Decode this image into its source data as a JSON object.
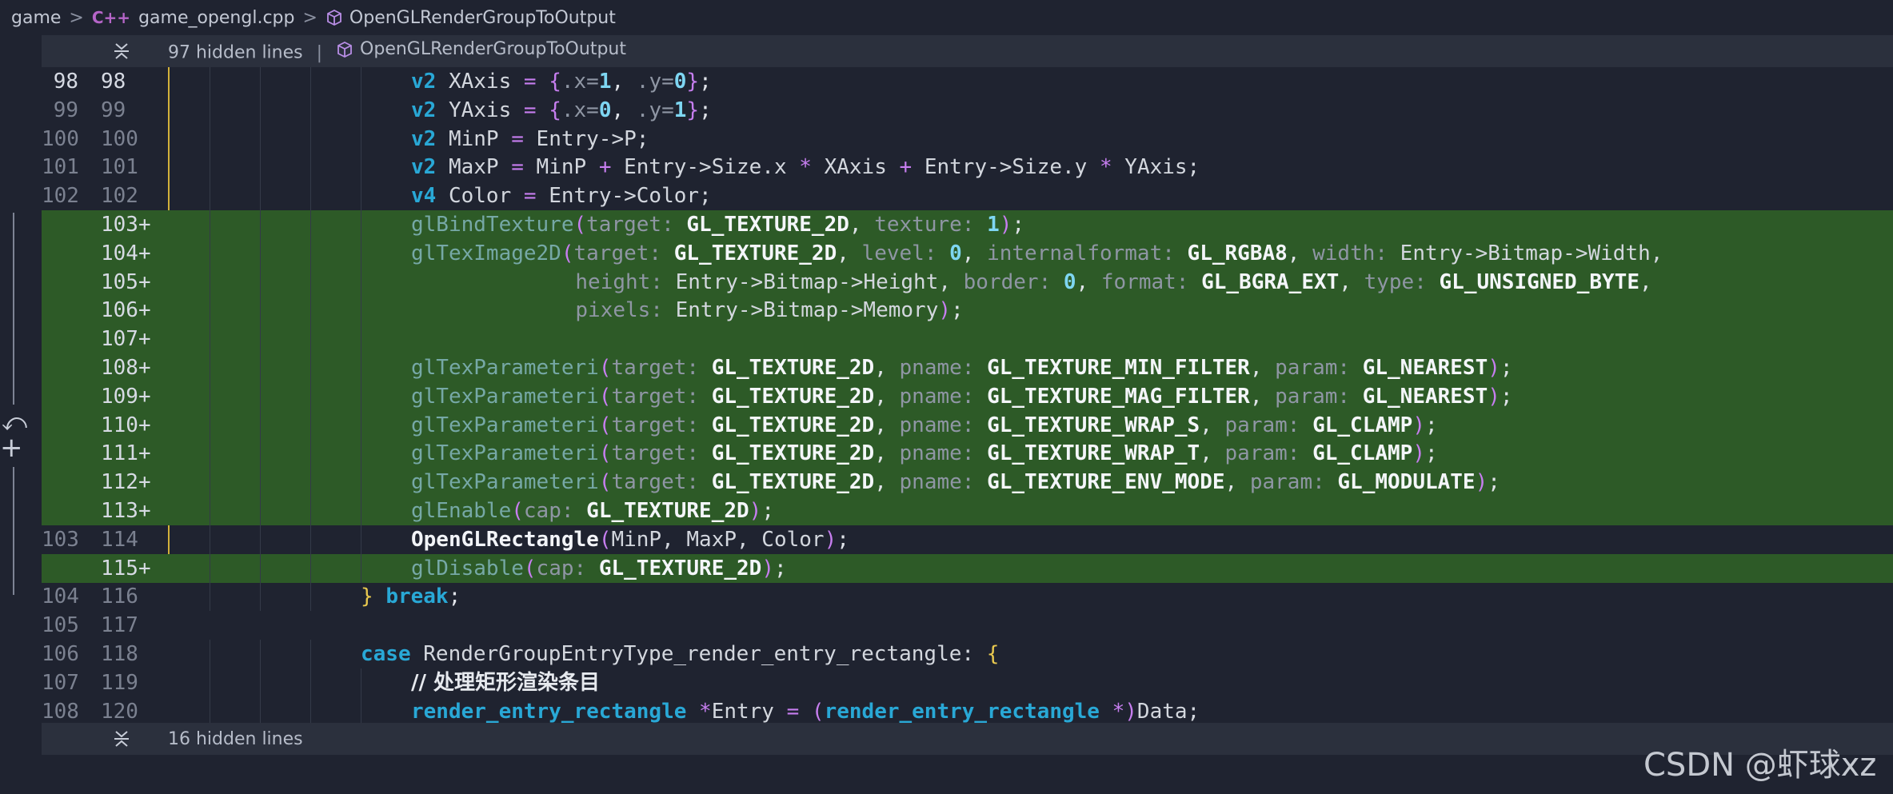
{
  "breadcrumb": {
    "folder": "game",
    "file": "game_opengl.cpp",
    "file_icon": "C++",
    "symbol": "OpenGLRenderGroupToOutput"
  },
  "fold_top": {
    "label": "97 hidden lines",
    "separator": "|",
    "function": "OpenGLRenderGroupToOutput"
  },
  "fold_bottom": {
    "label": "16 hidden lines"
  },
  "colors": {
    "background": "#1f2330",
    "added_line": "#2d5a27",
    "keyword": "#29a8d6",
    "change_marker": "#d2b13a"
  },
  "lines": [
    {
      "old": "98",
      "new": "98",
      "added": false,
      "current": true,
      "indent": 4,
      "tokens": [
        {
          "t": "v2",
          "c": "kw"
        },
        {
          "t": " XAxis ",
          "c": "plain"
        },
        {
          "t": "=",
          "c": "op"
        },
        {
          "t": " ",
          "c": "plain"
        },
        {
          "t": "{",
          "c": "op"
        },
        {
          "t": ".x=",
          "c": "hint"
        },
        {
          "t": "1",
          "c": "num"
        },
        {
          "t": ", ",
          "c": "pun"
        },
        {
          "t": ".y=",
          "c": "hint"
        },
        {
          "t": "0",
          "c": "num"
        },
        {
          "t": "}",
          "c": "op"
        },
        {
          "t": ";",
          "c": "pun"
        }
      ]
    },
    {
      "old": "99",
      "new": "99",
      "added": false,
      "indent": 4,
      "tokens": [
        {
          "t": "v2",
          "c": "kw"
        },
        {
          "t": " YAxis ",
          "c": "plain"
        },
        {
          "t": "=",
          "c": "op"
        },
        {
          "t": " ",
          "c": "plain"
        },
        {
          "t": "{",
          "c": "op"
        },
        {
          "t": ".x=",
          "c": "hint"
        },
        {
          "t": "0",
          "c": "num"
        },
        {
          "t": ", ",
          "c": "pun"
        },
        {
          "t": ".y=",
          "c": "hint"
        },
        {
          "t": "1",
          "c": "num"
        },
        {
          "t": "}",
          "c": "op"
        },
        {
          "t": ";",
          "c": "pun"
        }
      ]
    },
    {
      "old": "100",
      "new": "100",
      "added": false,
      "indent": 4,
      "tokens": [
        {
          "t": "v2",
          "c": "kw"
        },
        {
          "t": " MinP ",
          "c": "plain"
        },
        {
          "t": "=",
          "c": "op"
        },
        {
          "t": " Entry->P;",
          "c": "plain"
        }
      ]
    },
    {
      "old": "101",
      "new": "101",
      "added": false,
      "indent": 4,
      "tokens": [
        {
          "t": "v2",
          "c": "kw"
        },
        {
          "t": " MaxP ",
          "c": "plain"
        },
        {
          "t": "=",
          "c": "op"
        },
        {
          "t": " MinP ",
          "c": "plain"
        },
        {
          "t": "+",
          "c": "op"
        },
        {
          "t": " Entry->Size.x ",
          "c": "plain"
        },
        {
          "t": "*",
          "c": "op"
        },
        {
          "t": " XAxis ",
          "c": "plain"
        },
        {
          "t": "+",
          "c": "op"
        },
        {
          "t": " Entry->Size.y ",
          "c": "plain"
        },
        {
          "t": "*",
          "c": "op"
        },
        {
          "t": " YAxis;",
          "c": "plain"
        }
      ]
    },
    {
      "old": "102",
      "new": "102",
      "added": false,
      "indent": 4,
      "tokens": [
        {
          "t": "v4",
          "c": "kw"
        },
        {
          "t": " Color ",
          "c": "plain"
        },
        {
          "t": "=",
          "c": "op"
        },
        {
          "t": " Entry->Color;",
          "c": "plain"
        }
      ]
    },
    {
      "old": "",
      "new": "103+",
      "added": true,
      "indent": 4,
      "tokens": [
        {
          "t": "glBindTexture",
          "c": "gfn"
        },
        {
          "t": "(",
          "c": "op"
        },
        {
          "t": "target:",
          "c": "hint"
        },
        {
          "t": " GL_TEXTURE_2D",
          "c": "const"
        },
        {
          "t": ", ",
          "c": "pun"
        },
        {
          "t": "texture:",
          "c": "hint"
        },
        {
          "t": " 1",
          "c": "num"
        },
        {
          "t": ")",
          "c": "op"
        },
        {
          "t": ";",
          "c": "pun"
        }
      ]
    },
    {
      "old": "",
      "new": "104+",
      "added": true,
      "indent": 4,
      "tokens": [
        {
          "t": "glTexImage2D",
          "c": "gfn"
        },
        {
          "t": "(",
          "c": "op"
        },
        {
          "t": "target:",
          "c": "hint"
        },
        {
          "t": " GL_TEXTURE_2D",
          "c": "const"
        },
        {
          "t": ", ",
          "c": "pun"
        },
        {
          "t": "level:",
          "c": "hint"
        },
        {
          "t": " 0",
          "c": "num"
        },
        {
          "t": ", ",
          "c": "pun"
        },
        {
          "t": "internalformat:",
          "c": "hint"
        },
        {
          "t": " GL_RGBA8",
          "c": "const"
        },
        {
          "t": ", ",
          "c": "pun"
        },
        {
          "t": "width:",
          "c": "hint"
        },
        {
          "t": " Entry->Bitmap->Width,",
          "c": "plain"
        }
      ]
    },
    {
      "old": "",
      "new": "105+",
      "added": true,
      "indent": 4,
      "extra_col": 13,
      "tokens": [
        {
          "t": "height:",
          "c": "hint"
        },
        {
          "t": " Entry->Bitmap->Height, ",
          "c": "plain"
        },
        {
          "t": "border:",
          "c": "hint"
        },
        {
          "t": " 0",
          "c": "num"
        },
        {
          "t": ", ",
          "c": "pun"
        },
        {
          "t": "format:",
          "c": "hint"
        },
        {
          "t": " GL_BGRA_EXT",
          "c": "const"
        },
        {
          "t": ", ",
          "c": "pun"
        },
        {
          "t": "type:",
          "c": "hint"
        },
        {
          "t": " GL_UNSIGNED_BYTE",
          "c": "const"
        },
        {
          "t": ",",
          "c": "pun"
        }
      ]
    },
    {
      "old": "",
      "new": "106+",
      "added": true,
      "indent": 4,
      "extra_col": 13,
      "tokens": [
        {
          "t": "pixels:",
          "c": "hint"
        },
        {
          "t": " Entry->Bitmap->Memory",
          "c": "plain"
        },
        {
          "t": ")",
          "c": "op"
        },
        {
          "t": ";",
          "c": "pun"
        }
      ]
    },
    {
      "old": "",
      "new": "107+",
      "added": true,
      "indent": 4,
      "tokens": []
    },
    {
      "old": "",
      "new": "108+",
      "added": true,
      "indent": 4,
      "tokens": [
        {
          "t": "glTexParameteri",
          "c": "gfn"
        },
        {
          "t": "(",
          "c": "op"
        },
        {
          "t": "target:",
          "c": "hint"
        },
        {
          "t": " GL_TEXTURE_2D",
          "c": "const"
        },
        {
          "t": ", ",
          "c": "pun"
        },
        {
          "t": "pname:",
          "c": "hint"
        },
        {
          "t": " GL_TEXTURE_MIN_FILTER",
          "c": "const"
        },
        {
          "t": ", ",
          "c": "pun"
        },
        {
          "t": "param:",
          "c": "hint"
        },
        {
          "t": " GL_NEAREST",
          "c": "const"
        },
        {
          "t": ")",
          "c": "op"
        },
        {
          "t": ";",
          "c": "pun"
        }
      ]
    },
    {
      "old": "",
      "new": "109+",
      "added": true,
      "indent": 4,
      "tokens": [
        {
          "t": "glTexParameteri",
          "c": "gfn"
        },
        {
          "t": "(",
          "c": "op"
        },
        {
          "t": "target:",
          "c": "hint"
        },
        {
          "t": " GL_TEXTURE_2D",
          "c": "const"
        },
        {
          "t": ", ",
          "c": "pun"
        },
        {
          "t": "pname:",
          "c": "hint"
        },
        {
          "t": " GL_TEXTURE_MAG_FILTER",
          "c": "const"
        },
        {
          "t": ", ",
          "c": "pun"
        },
        {
          "t": "param:",
          "c": "hint"
        },
        {
          "t": " GL_NEAREST",
          "c": "const"
        },
        {
          "t": ")",
          "c": "op"
        },
        {
          "t": ";",
          "c": "pun"
        }
      ]
    },
    {
      "old": "",
      "new": "110+",
      "added": true,
      "indent": 4,
      "tokens": [
        {
          "t": "glTexParameteri",
          "c": "gfn"
        },
        {
          "t": "(",
          "c": "op"
        },
        {
          "t": "target:",
          "c": "hint"
        },
        {
          "t": " GL_TEXTURE_2D",
          "c": "const"
        },
        {
          "t": ", ",
          "c": "pun"
        },
        {
          "t": "pname:",
          "c": "hint"
        },
        {
          "t": " GL_TEXTURE_WRAP_S",
          "c": "const"
        },
        {
          "t": ", ",
          "c": "pun"
        },
        {
          "t": "param:",
          "c": "hint"
        },
        {
          "t": " GL_CLAMP",
          "c": "const"
        },
        {
          "t": ")",
          "c": "op"
        },
        {
          "t": ";",
          "c": "pun"
        }
      ]
    },
    {
      "old": "",
      "new": "111+",
      "added": true,
      "indent": 4,
      "tokens": [
        {
          "t": "glTexParameteri",
          "c": "gfn"
        },
        {
          "t": "(",
          "c": "op"
        },
        {
          "t": "target:",
          "c": "hint"
        },
        {
          "t": " GL_TEXTURE_2D",
          "c": "const"
        },
        {
          "t": ", ",
          "c": "pun"
        },
        {
          "t": "pname:",
          "c": "hint"
        },
        {
          "t": " GL_TEXTURE_WRAP_T",
          "c": "const"
        },
        {
          "t": ", ",
          "c": "pun"
        },
        {
          "t": "param:",
          "c": "hint"
        },
        {
          "t": " GL_CLAMP",
          "c": "const"
        },
        {
          "t": ")",
          "c": "op"
        },
        {
          "t": ";",
          "c": "pun"
        }
      ]
    },
    {
      "old": "",
      "new": "112+",
      "added": true,
      "indent": 4,
      "tokens": [
        {
          "t": "glTexParameteri",
          "c": "gfn"
        },
        {
          "t": "(",
          "c": "op"
        },
        {
          "t": "target:",
          "c": "hint"
        },
        {
          "t": " GL_TEXTURE_2D",
          "c": "const"
        },
        {
          "t": ", ",
          "c": "pun"
        },
        {
          "t": "pname:",
          "c": "hint"
        },
        {
          "t": " GL_TEXTURE_ENV_MODE",
          "c": "const"
        },
        {
          "t": ", ",
          "c": "pun"
        },
        {
          "t": "param:",
          "c": "hint"
        },
        {
          "t": " GL_MODULATE",
          "c": "const"
        },
        {
          "t": ")",
          "c": "op"
        },
        {
          "t": ";",
          "c": "pun"
        }
      ]
    },
    {
      "old": "",
      "new": "113+",
      "added": true,
      "indent": 4,
      "tokens": [
        {
          "t": "glEnable",
          "c": "gfn"
        },
        {
          "t": "(",
          "c": "op"
        },
        {
          "t": "cap:",
          "c": "hint"
        },
        {
          "t": " GL_TEXTURE_2D",
          "c": "const"
        },
        {
          "t": ")",
          "c": "op"
        },
        {
          "t": ";",
          "c": "pun"
        }
      ]
    },
    {
      "old": "103",
      "new": "114",
      "added": false,
      "indent": 4,
      "tokens": [
        {
          "t": "OpenGLRectangle",
          "c": "fn"
        },
        {
          "t": "(",
          "c": "op"
        },
        {
          "t": "MinP, MaxP, Color",
          "c": "plain"
        },
        {
          "t": ")",
          "c": "op"
        },
        {
          "t": ";",
          "c": "pun"
        }
      ]
    },
    {
      "old": "",
      "new": "115+",
      "added": true,
      "indent": 4,
      "tokens": [
        {
          "t": "glDisable",
          "c": "gfn"
        },
        {
          "t": "(",
          "c": "op"
        },
        {
          "t": "cap:",
          "c": "hint"
        },
        {
          "t": " GL_TEXTURE_2D",
          "c": "const"
        },
        {
          "t": ")",
          "c": "op"
        },
        {
          "t": ";",
          "c": "pun"
        }
      ]
    },
    {
      "old": "104",
      "new": "116",
      "added": false,
      "indent": 3,
      "tokens": [
        {
          "t": "}",
          "c": "brk"
        },
        {
          "t": " ",
          "c": "plain"
        },
        {
          "t": "break",
          "c": "kw"
        },
        {
          "t": ";",
          "c": "pun"
        }
      ]
    },
    {
      "old": "105",
      "new": "117",
      "added": false,
      "indent": 0,
      "tokens": []
    },
    {
      "old": "106",
      "new": "118",
      "added": false,
      "indent": 3,
      "tokens": [
        {
          "t": "case",
          "c": "kw"
        },
        {
          "t": " RenderGroupEntryType_render_entry_rectangle: ",
          "c": "plain"
        },
        {
          "t": "{",
          "c": "yel"
        }
      ]
    },
    {
      "old": "107",
      "new": "119",
      "added": false,
      "indent": 4,
      "tokens": [
        {
          "t": "// 处理矩形渲染条目",
          "c": "cmt"
        }
      ]
    },
    {
      "old": "108",
      "new": "120",
      "added": false,
      "indent": 4,
      "tokens": [
        {
          "t": "render_entry_rectangle",
          "c": "kw"
        },
        {
          "t": " ",
          "c": "plain"
        },
        {
          "t": "*",
          "c": "op"
        },
        {
          "t": "Entry ",
          "c": "plain"
        },
        {
          "t": "=",
          "c": "op"
        },
        {
          "t": " ",
          "c": "plain"
        },
        {
          "t": "(",
          "c": "op"
        },
        {
          "t": "render_entry_rectangle",
          "c": "kw"
        },
        {
          "t": " ",
          "c": "plain"
        },
        {
          "t": "*",
          "c": "op"
        },
        {
          "t": ")",
          "c": "op"
        },
        {
          "t": "Data;",
          "c": "plain"
        }
      ]
    }
  ],
  "watermark": "CSDN @虾球xz"
}
